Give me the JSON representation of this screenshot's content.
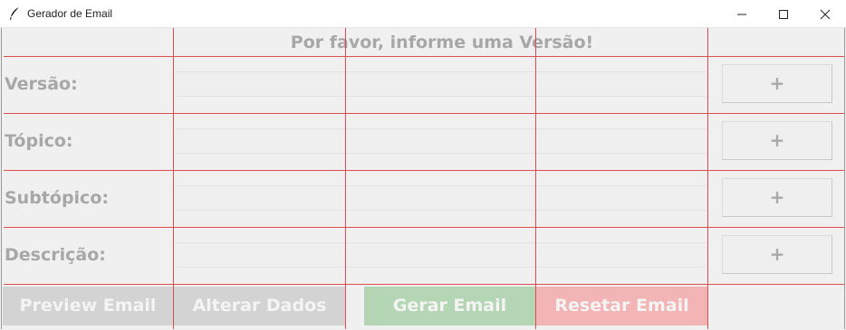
{
  "window": {
    "title": "Gerador de Email",
    "controls": [
      "minimize-icon",
      "maximize-icon",
      "close-icon"
    ]
  },
  "form": {
    "heading": "Por favor, informe uma Versão!",
    "rows": [
      {
        "label": "Versão:",
        "add_label": "+"
      },
      {
        "label": "Tópico:",
        "add_label": "+"
      },
      {
        "label": "Subtópico:",
        "add_label": "+"
      },
      {
        "label": "Descrição:",
        "add_label": "+"
      }
    ]
  },
  "actions": {
    "preview": "Preview Email",
    "alterar": "Alterar Dados",
    "gerar": "Gerar Email",
    "resetar": "Resetar Email"
  },
  "colors": {
    "grid_line": "#d94f4f",
    "preview_bg": "#d3d3d3",
    "alterar_bg": "#d3d3d3",
    "gerar_bg": "#b5d6b5",
    "resetar_bg": "#f2b4b4",
    "label_text": "#a7a7a7"
  }
}
